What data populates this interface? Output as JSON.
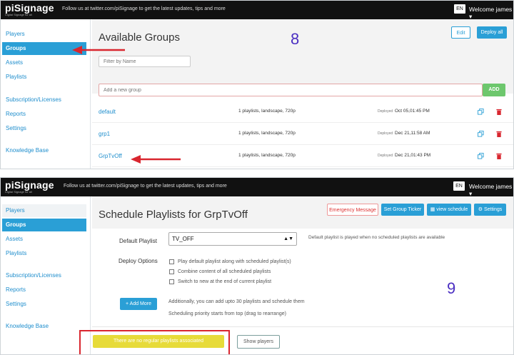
{
  "header": {
    "logo": "piSignage",
    "tagline": "Digital Signage for all",
    "follow_text": "Follow us at twitter.com/piSignage to get the latest updates, tips and more",
    "lang": "EN",
    "welcome": "Welcome james ▾"
  },
  "sidebar": {
    "items": [
      "Players",
      "Groups",
      "Assets",
      "Playlists",
      "Subscription/Licenses",
      "Reports",
      "Settings",
      "Knowledge Base"
    ]
  },
  "groups_page": {
    "title": "Available Groups",
    "step_number": "8",
    "edit_label": "Edit",
    "deploy_all_label": "Deploy all",
    "filter_placeholder": "Filter by Name",
    "add_group_placeholder": "Add a new group",
    "add_label": "ADD",
    "deployed_label": "Deployed",
    "rows": [
      {
        "name": "default",
        "info": "1 playlists, landscape, 720p",
        "deployed": "Oct 05,01:45 PM"
      },
      {
        "name": "grp1",
        "info": "1 playlists, landscape, 720p",
        "deployed": "Dec 21,11:58 AM"
      },
      {
        "name": "GrpTvOff",
        "info": "1 playlists, landscape, 720p",
        "deployed": "Dec 21,01:43 PM"
      }
    ]
  },
  "schedule_page": {
    "title": "Schedule Playlists for GrpTvOff",
    "step_number": "9",
    "emergency_label": "Emergency Message",
    "ticker_label": "Set Group Ticker",
    "view_schedule_label": "view schedule",
    "settings_label": "Settings",
    "default_playlist_label": "Default Playlist",
    "default_playlist_value": "TV_OFF",
    "default_playlist_help": "Default playlist is played when no scheduled playlists are available",
    "deploy_options_label": "Deploy Options",
    "options": [
      "Play default playlist along with scheduled playlist(s)",
      "Combine content of all scheduled playlists",
      "Switch to new at the end of current playlist"
    ],
    "add_more_label": "+ Add More",
    "add_more_help_1": "Additionally, you can add upto 30 playlists and schedule them",
    "add_more_help_2": "Scheduling priority starts from top (drag to rearrange)",
    "no_playlists_label": "There are no regular playlists associated",
    "show_players_label": "Show players"
  },
  "colors": {
    "accent": "#2a9fd6",
    "annotation_red": "#d9262f",
    "annotation_number": "#4b2fc2"
  }
}
